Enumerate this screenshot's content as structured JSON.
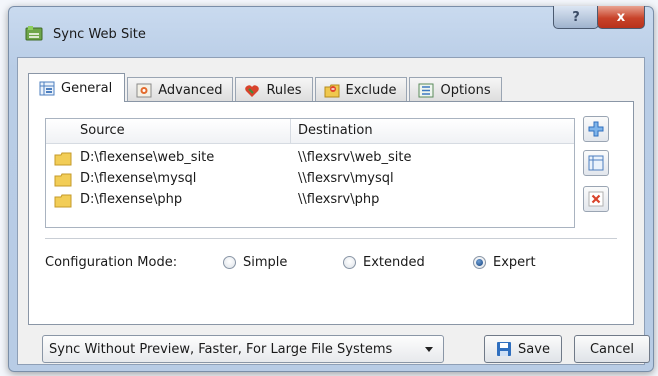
{
  "window": {
    "title": "Sync Web Site",
    "help_label": "?",
    "close_label": "x"
  },
  "tabs": [
    {
      "label": "General",
      "icon": "general-icon",
      "active": true
    },
    {
      "label": "Advanced",
      "icon": "advanced-icon",
      "active": false
    },
    {
      "label": "Rules",
      "icon": "rules-icon",
      "active": false
    },
    {
      "label": "Exclude",
      "icon": "exclude-icon",
      "active": false
    },
    {
      "label": "Options",
      "icon": "options-icon",
      "active": false
    }
  ],
  "table": {
    "columns": [
      "Source",
      "Destination"
    ],
    "rows": [
      {
        "source": "D:\\flexense\\web_site",
        "destination": "\\\\flexsrv\\web_site"
      },
      {
        "source": "D:\\flexense\\mysql",
        "destination": "\\\\flexsrv\\mysql"
      },
      {
        "source": "D:\\flexense\\php",
        "destination": "\\\\flexsrv\\php"
      }
    ]
  },
  "side_buttons": [
    "add-icon",
    "edit-icon",
    "delete-icon"
  ],
  "config": {
    "label": "Configuration Mode:",
    "options": [
      "Simple",
      "Extended",
      "Expert"
    ],
    "selected": "Expert"
  },
  "footer": {
    "mode_value": "Sync Without Preview, Faster, For Large File Systems",
    "save_label": "Save",
    "cancel_label": "Cancel"
  },
  "colors": {
    "accent": "#2f6fbf",
    "close": "#c8432a",
    "folder": "#e8c04a",
    "delete": "#d9442c"
  }
}
